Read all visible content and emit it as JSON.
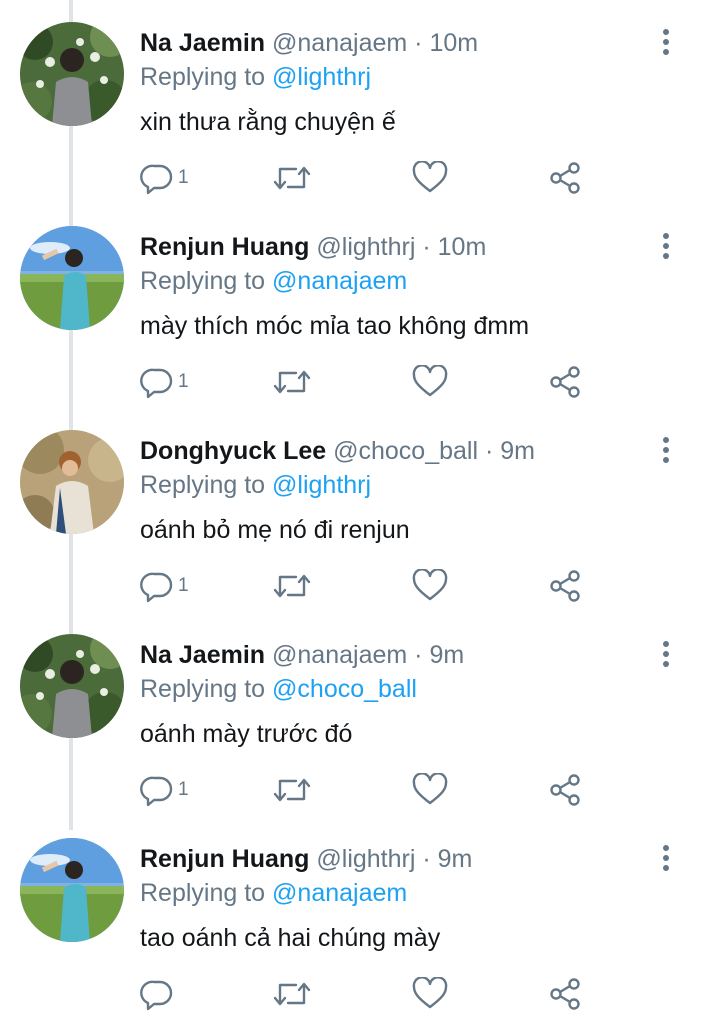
{
  "colors": {
    "text": "#14171a",
    "muted": "#657786",
    "mention": "#1da1f2",
    "thread_line": "#e1e4e6"
  },
  "tweets": [
    {
      "name": "Na Jaemin",
      "handle": "@nanajaem",
      "separator": "·",
      "time": "10m",
      "replying_prefix": "Replying to",
      "replying_to": "@lighthrj",
      "text": "xin thưa rằng chuyện ế",
      "reply_count": "1",
      "avatar": "jaemin-avatar"
    },
    {
      "name": "Renjun Huang",
      "handle": "@lighthrj",
      "separator": "·",
      "time": "10m",
      "replying_prefix": "Replying to",
      "replying_to": "@nanajaem",
      "text": "mày thích móc mỉa tao không đmm",
      "reply_count": "1",
      "avatar": "renjun-avatar"
    },
    {
      "name": "Donghyuck Lee",
      "handle": "@choco_ball",
      "separator": "·",
      "time": "9m",
      "replying_prefix": "Replying to",
      "replying_to": "@lighthrj",
      "text": "oánh bỏ mẹ nó đi renjun",
      "reply_count": "1",
      "avatar": "donghyuck-avatar"
    },
    {
      "name": "Na Jaemin",
      "handle": "@nanajaem",
      "separator": "·",
      "time": "9m",
      "replying_prefix": "Replying to",
      "replying_to": "@choco_ball",
      "text": "oánh mày trước đó",
      "reply_count": "1",
      "avatar": "jaemin-avatar"
    },
    {
      "name": "Renjun Huang",
      "handle": "@lighthrj",
      "separator": "·",
      "time": "9m",
      "replying_prefix": "Replying to",
      "replying_to": "@nanajaem",
      "text": "tao oánh cả hai chúng mày",
      "reply_count": "",
      "avatar": "renjun-avatar"
    }
  ]
}
